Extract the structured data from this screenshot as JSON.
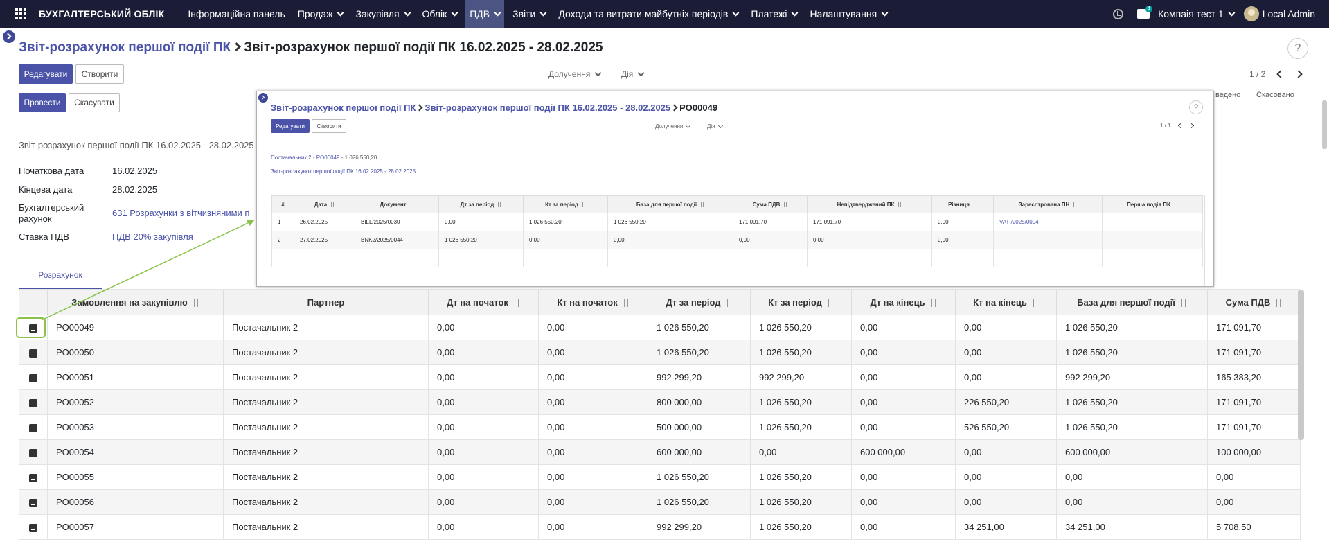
{
  "navbar": {
    "brand": "БУХГАЛТЕРСЬКИЙ ОБЛІК",
    "menu": [
      {
        "label": "Інформаційна панель",
        "dropdown": false
      },
      {
        "label": "Продаж",
        "dropdown": true
      },
      {
        "label": "Закупівля",
        "dropdown": true
      },
      {
        "label": "Облік",
        "dropdown": true
      },
      {
        "label": "ПДВ",
        "dropdown": true,
        "active": true
      },
      {
        "label": "Звіти",
        "dropdown": true
      },
      {
        "label": "Доходи та витрати майбутніх періодів",
        "dropdown": true
      },
      {
        "label": "Платежі",
        "dropdown": true
      },
      {
        "label": "Налаштування",
        "dropdown": true
      }
    ],
    "chat_badge": "4",
    "company": "Компаія тест 1",
    "user": "Local Admin",
    "colors": {
      "bar": "#1b1d37",
      "active": "#4c5483",
      "accent": "#4a53a7",
      "highlight": "#8bc34a"
    }
  },
  "breadcrumb": {
    "parent": "Звіт-розрахунок першої події ПК",
    "current": "Звіт-розрахунок першої події ПК 16.02.2025 - 28.02.2025"
  },
  "help": "?",
  "toolbar": {
    "edit": "Редагувати",
    "create": "Створити",
    "attachments": "Долучення",
    "action": "Дія",
    "pager": "1 / 2"
  },
  "statusbar": {
    "post": "Провести",
    "cancel": "Скасувати",
    "stage_partial": "ведено",
    "stage_cancelled": "Скасовано"
  },
  "form": {
    "title": "Звіт-розрахунок першої події ПК 16.02.2025 - 28.02.2025",
    "fields": [
      {
        "label": "Початкова дата",
        "value": "16.02.2025",
        "link": false
      },
      {
        "label": "Кінцева дата",
        "value": "28.02.2025",
        "link": false
      },
      {
        "label": "Бухгалтерський рахунок",
        "value": "631 Розрахунки з вітчизняними п",
        "link": true
      },
      {
        "label": "Ставка ПДВ",
        "value": "ПДВ 20% закупівля",
        "link": true
      }
    ]
  },
  "tab": {
    "label": "Розрахунок"
  },
  "main_table": {
    "headers": [
      "Замовлення на закупівлю",
      "Партнер",
      "Дт на початок",
      "Кт на початок",
      "Дт за період",
      "Кт за період",
      "Дт на кінець",
      "Кт на кінець",
      "База для першої події",
      "Сума ПДВ"
    ],
    "rows": [
      [
        "PO00049",
        "Постачальник 2",
        "0,00",
        "0,00",
        "1 026 550,20",
        "1 026 550,20",
        "0,00",
        "0,00",
        "1 026 550,20",
        "171 091,70"
      ],
      [
        "PO00050",
        "Постачальник 2",
        "0,00",
        "0,00",
        "1 026 550,20",
        "1 026 550,20",
        "0,00",
        "0,00",
        "1 026 550,20",
        "171 091,70"
      ],
      [
        "PO00051",
        "Постачальник 2",
        "0,00",
        "0,00",
        "992 299,20",
        "992 299,20",
        "0,00",
        "0,00",
        "992 299,20",
        "165 383,20"
      ],
      [
        "PO00052",
        "Постачальник 2",
        "0,00",
        "0,00",
        "800 000,00",
        "1 026 550,20",
        "0,00",
        "226 550,20",
        "1 026 550,20",
        "171 091,70"
      ],
      [
        "PO00053",
        "Постачальник 2",
        "0,00",
        "0,00",
        "500 000,00",
        "1 026 550,20",
        "0,00",
        "526 550,20",
        "1 026 550,20",
        "171 091,70"
      ],
      [
        "PO00054",
        "Постачальник 2",
        "0,00",
        "0,00",
        "600 000,00",
        "0,00",
        "600 000,00",
        "0,00",
        "600 000,00",
        "100 000,00"
      ],
      [
        "PO00055",
        "Постачальник 2",
        "0,00",
        "0,00",
        "1 026 550,20",
        "1 026 550,20",
        "0,00",
        "0,00",
        "0,00",
        "0,00"
      ],
      [
        "PO00056",
        "Постачальник 2",
        "0,00",
        "0,00",
        "1 026 550,20",
        "1 026 550,20",
        "0,00",
        "0,00",
        "0,00",
        "0,00"
      ],
      [
        "PO00057",
        "Постачальник 2",
        "0,00",
        "0,00",
        "992 299,20",
        "1 026 550,20",
        "0,00",
        "34 251,00",
        "34 251,00",
        "5 708,50"
      ]
    ]
  },
  "popup": {
    "breadcrumb": {
      "root": "Звіт-розрахунок першої події ПК",
      "parent": "Звіт-розрахунок першої події ПК 16.02.2025 - 28.02.2025",
      "current": "PO00049"
    },
    "help": "?",
    "edit": "Редагувати",
    "create": "Створити",
    "attachments": "Долучення",
    "action": "Дія",
    "pager": "1 / 1",
    "meta_partner": "Постачальник 2",
    "meta_sep": "-",
    "meta_order": "PO00049",
    "meta_amount": "1 026 550,20",
    "meta_report": "Звіт-розрахунок першої події ПК 16.02.2025 - 28.02.2025",
    "table": {
      "headers": [
        "#",
        "Дата",
        "Документ",
        "Дт за період",
        "Кт за період",
        "База для першої події",
        "Сума ПДВ",
        "Непідтверджений ПК",
        "Різниця",
        "Зареєстрована ПН",
        "Перша подія ПК"
      ],
      "rows": [
        [
          "1",
          "26.02.2025",
          "BILL/2025/0030",
          "0,00",
          "1 026 550,20",
          "1 026 550,20",
          "171 091,70",
          "171 091,70",
          "0,00",
          "VATI/2025/0004",
          ""
        ],
        [
          "2",
          "27.02.2025",
          "BNK2/2025/0044",
          "1 026 550,20",
          "0,00",
          "0,00",
          "0,00",
          "0,00",
          "0,00",
          "",
          ""
        ]
      ]
    }
  }
}
